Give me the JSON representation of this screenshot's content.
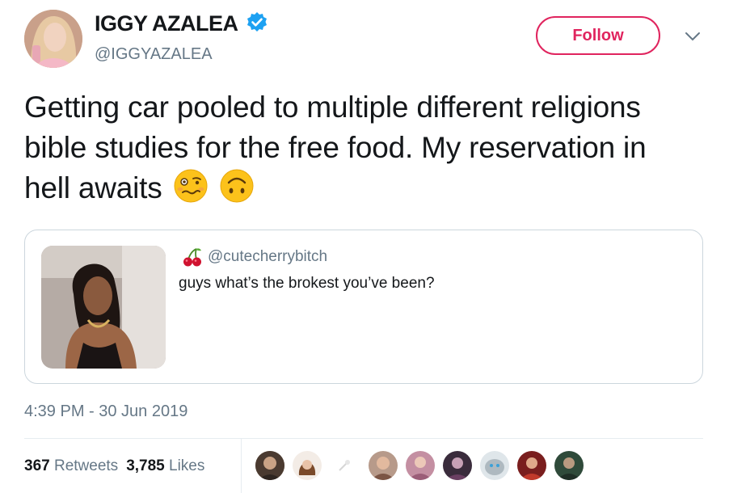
{
  "user": {
    "name": "IGGY AZALEA",
    "handle": "@IGGYAZALEA",
    "verified": true
  },
  "actions": {
    "follow_label": "Follow"
  },
  "tweet": {
    "text": "Getting car pooled to multiple different religions bible studies for the free food.  My reservation in hell awaits",
    "emojis": [
      "woozy-face-emoji",
      "upside-down-face-emoji"
    ]
  },
  "quoted_tweet": {
    "handle": "@cutecherrybitch",
    "handle_icon": "cherries-emoji",
    "text": "guys what’s the brokest you’ve been?"
  },
  "timestamp": "4:39 PM - 30 Jun 2019",
  "stats": {
    "retweets_count": "367",
    "retweets_label": "Retweets",
    "likes_count": "3,785",
    "likes_label": "Likes"
  },
  "likers_count_shown": 10,
  "colors": {
    "accent": "#e0245e",
    "verified_blue": "#1da1f2",
    "secondary_text": "#657786",
    "border": "#ccd6dd"
  }
}
